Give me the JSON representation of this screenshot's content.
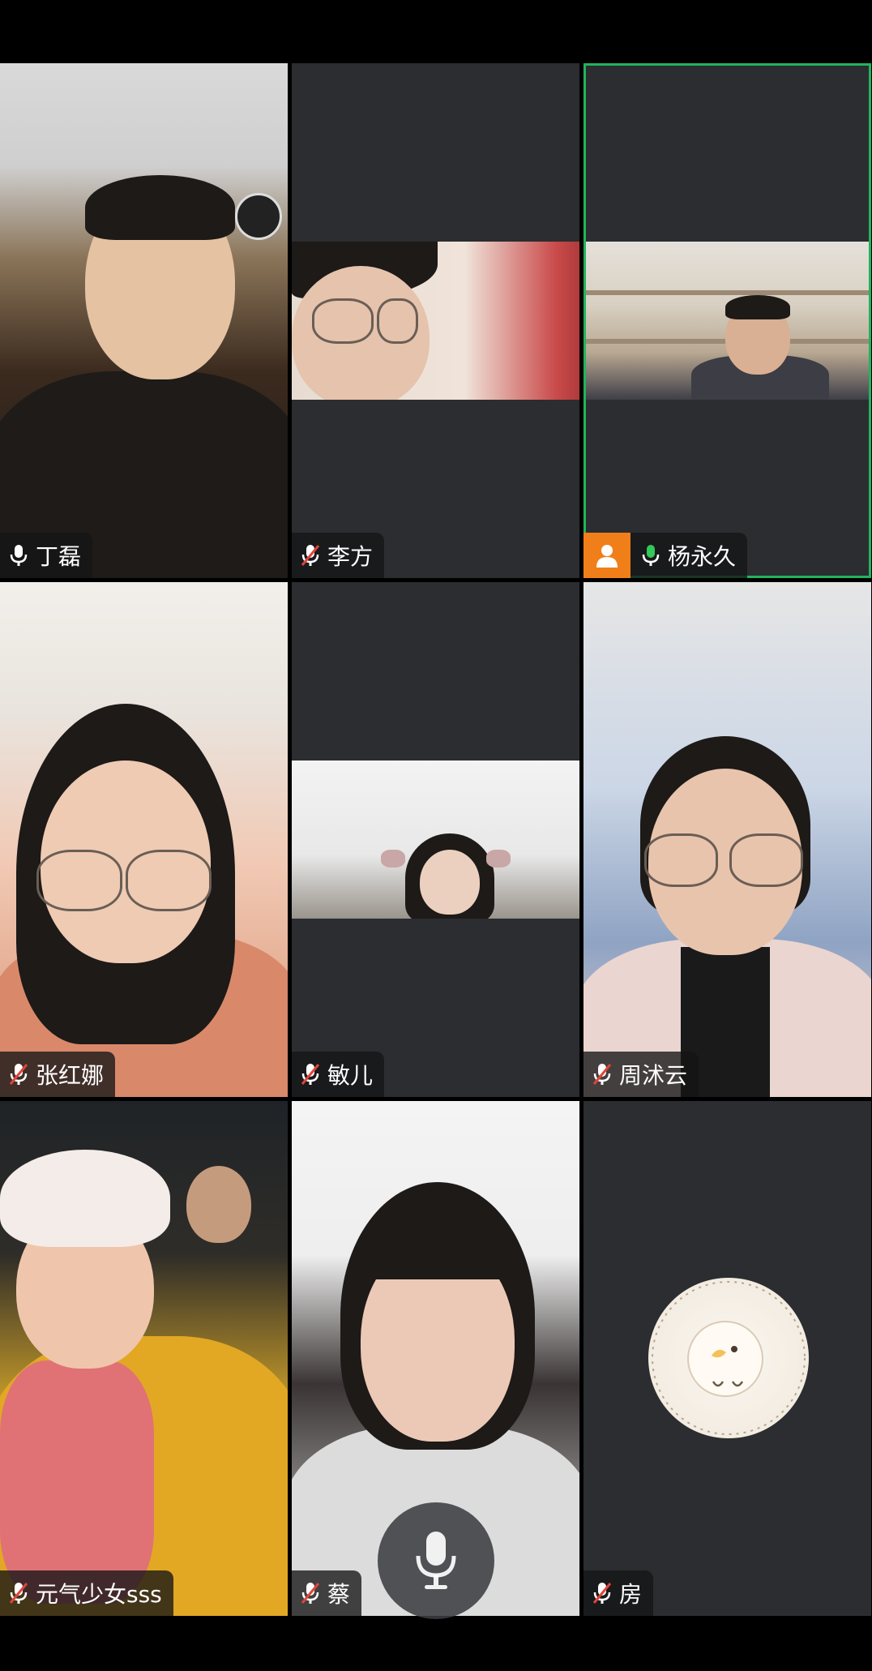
{
  "meeting": {
    "participants": [
      {
        "name": "丁磊",
        "muted": false,
        "speaking": false,
        "video": "full",
        "host": false
      },
      {
        "name": "李方",
        "muted": true,
        "speaking": false,
        "video": "band",
        "host": false
      },
      {
        "name": "杨永久",
        "muted": false,
        "speaking": true,
        "video": "band",
        "host": true,
        "active": true
      },
      {
        "name": "张红娜",
        "muted": true,
        "speaking": false,
        "video": "full",
        "host": false
      },
      {
        "name": "敏儿",
        "muted": true,
        "speaking": false,
        "video": "band",
        "host": false
      },
      {
        "name": "周沭云",
        "muted": true,
        "speaking": false,
        "video": "full",
        "host": false
      },
      {
        "name": "元气少女sss",
        "muted": true,
        "speaking": false,
        "video": "full",
        "host": false
      },
      {
        "name": "蔡",
        "muted": true,
        "speaking": false,
        "video": "full",
        "host": false
      },
      {
        "name": "房",
        "muted": true,
        "speaking": false,
        "video": "avatar",
        "host": false
      }
    ]
  },
  "colors": {
    "active_border": "#23b35d",
    "speaking_mic": "#34c759",
    "host_badge": "#f07f1a",
    "muted_slash": "#e0453a"
  },
  "icons": {
    "mic": "microphone-icon",
    "mic_muted": "microphone-muted-icon",
    "host": "person-icon"
  }
}
